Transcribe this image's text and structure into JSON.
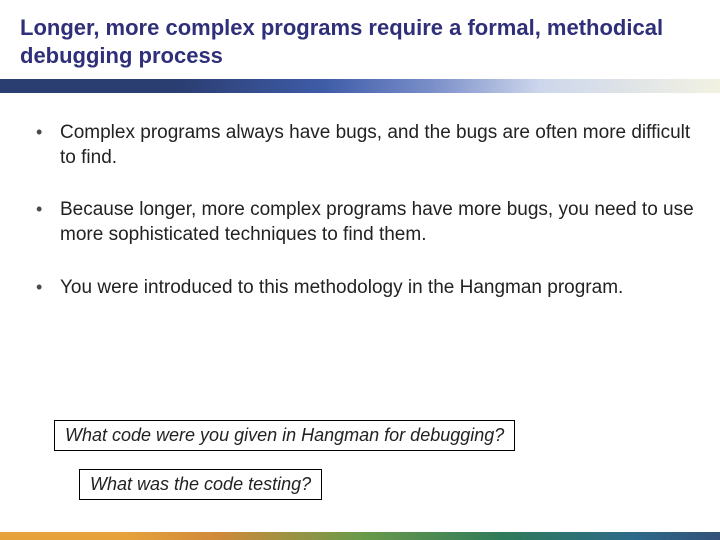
{
  "title": "Longer, more complex programs require a formal, methodical debugging process",
  "bullets": [
    "Complex programs always have bugs, and the bugs are often more difficult to find.",
    "Because longer, more complex programs have more bugs, you need to use more sophisticated techniques to find them.",
    "You were introduced to this methodology in the Hangman program."
  ],
  "questions": {
    "q1": "What code were you given in Hangman for debugging?",
    "q2": "What was the code testing?"
  }
}
